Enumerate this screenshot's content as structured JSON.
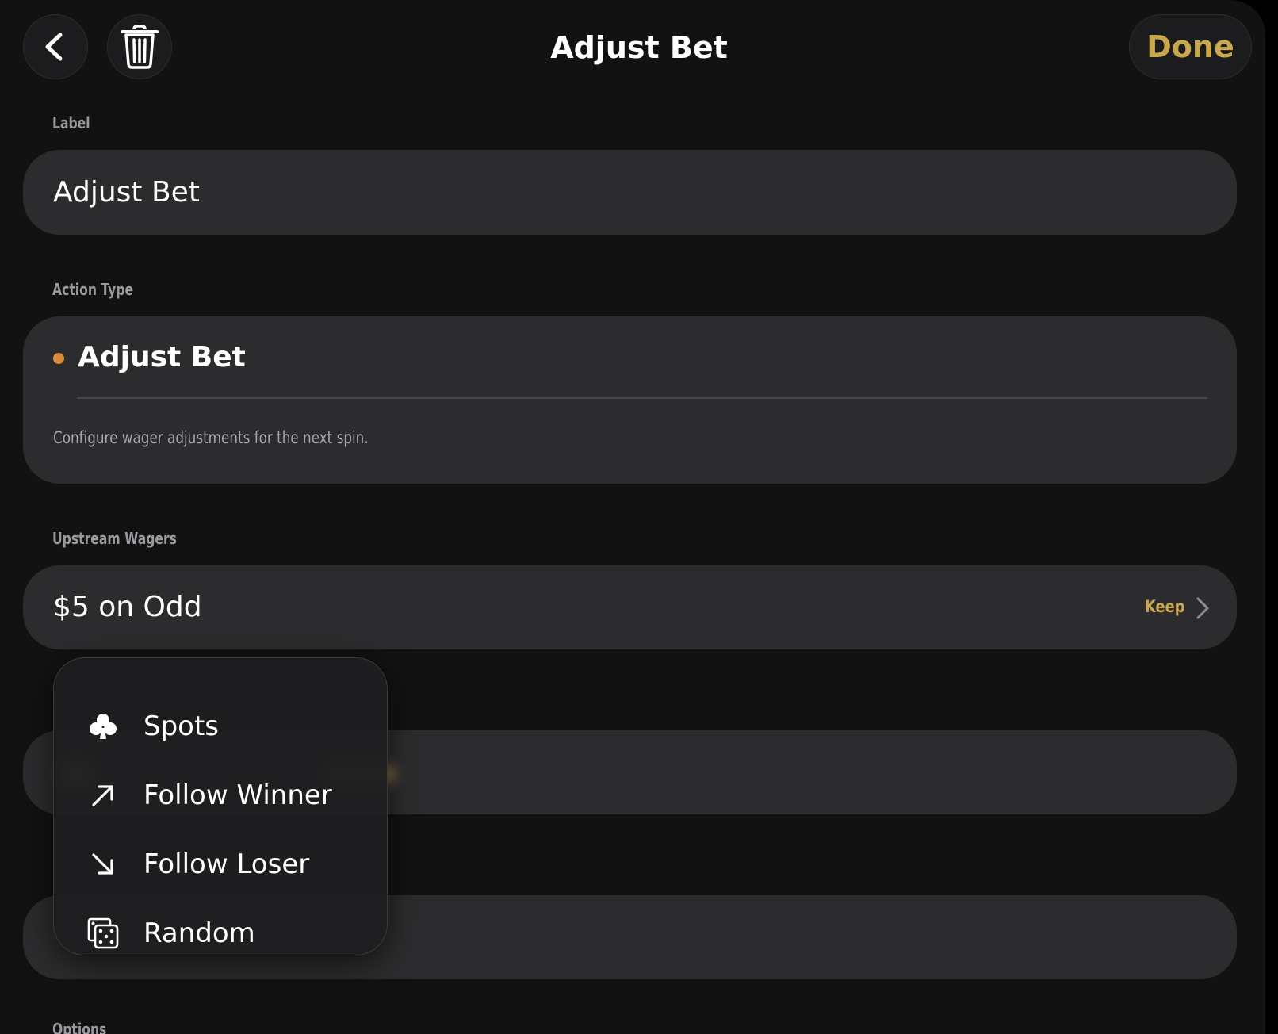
{
  "header": {
    "title": "Adjust Bet",
    "done_label": "Done",
    "back_icon": "chevron-left-icon",
    "trash_icon": "trash-icon"
  },
  "label_section": {
    "heading": "Label",
    "value": "Adjust Bet"
  },
  "action_type_section": {
    "heading": "Action Type",
    "selected": "Adjust Bet",
    "description": "Configure wager adjustments for the next spin.",
    "dot_color": "#d88c38"
  },
  "upstream_section": {
    "heading": "Upstream Wagers",
    "wager": "$5 on Odd",
    "mode": "Keep"
  },
  "options_section": {
    "heading": "Options"
  },
  "menu": {
    "items": [
      {
        "label": "Spots",
        "icon": "club-icon"
      },
      {
        "label": "Follow Winner",
        "icon": "arrow-up-right-icon"
      },
      {
        "label": "Follow Loser",
        "icon": "arrow-down-right-icon"
      },
      {
        "label": "Random",
        "icon": "dice-icon"
      }
    ]
  },
  "colors": {
    "accent": "#c9a84d",
    "background": "#121213",
    "card": "#2c2c2e"
  }
}
